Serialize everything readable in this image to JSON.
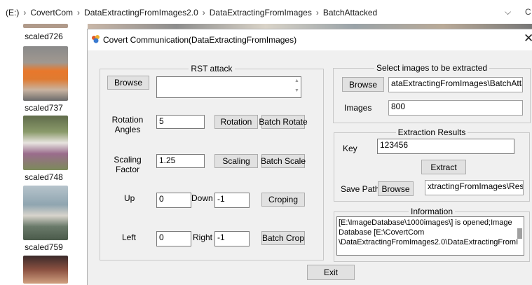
{
  "breadcrumb": {
    "items": [
      "(E:)",
      "CovertCom",
      "DataExtractingFromImages2.0",
      "DataExtractingFromImages",
      "BatchAttacked"
    ]
  },
  "thumbnails": [
    {
      "label": "scaled726"
    },
    {
      "label": "scaled737"
    },
    {
      "label": "scaled748"
    },
    {
      "label": "scaled759"
    }
  ],
  "dialog": {
    "title": "Covert Communication(DataExtractingFromImages)",
    "rst": {
      "legend": "RST attack",
      "browse_label": "Browse",
      "rotation_label": "Rotation Angles",
      "rotation_value": "5",
      "rotation_button": "Rotation",
      "batch_rotate_button": "Batch Rotate",
      "scaling_label": "Scaling Factor",
      "scaling_value": "1.25",
      "scaling_button": "Scaling",
      "batch_scale_button": "Batch Scale",
      "up_label": "Up",
      "up_value": "0",
      "down_label": "Down",
      "down_value": "-1",
      "croping_button": "Croping",
      "left_label": "Left",
      "left_value": "0",
      "right_label": "Right",
      "right_value": "-1",
      "batch_crop_button": "Batch Crop"
    },
    "select": {
      "legend": "Select images to be extracted",
      "browse_label": "Browse",
      "path_value": "ataExtractingFromImages\\BatchAttacked\\",
      "images_label": "Images",
      "images_value": "800"
    },
    "extraction": {
      "legend": "Extraction Results",
      "key_label": "Key",
      "key_value": "123456",
      "extract_button": "Extract",
      "save_path_label": "Save Path",
      "browse_label": "Browse",
      "save_path_value": "xtractingFromImages\\Results\\"
    },
    "information": {
      "legend": "Information",
      "line1": "[E:\\ImageDatabase\\1000images\\] is opened;Image",
      "line2": "Database [E:\\CovertCom",
      "line3": "\\DataExtractingFromImages2.0\\DataExtractingFromI"
    },
    "exit_button": "Exit"
  }
}
